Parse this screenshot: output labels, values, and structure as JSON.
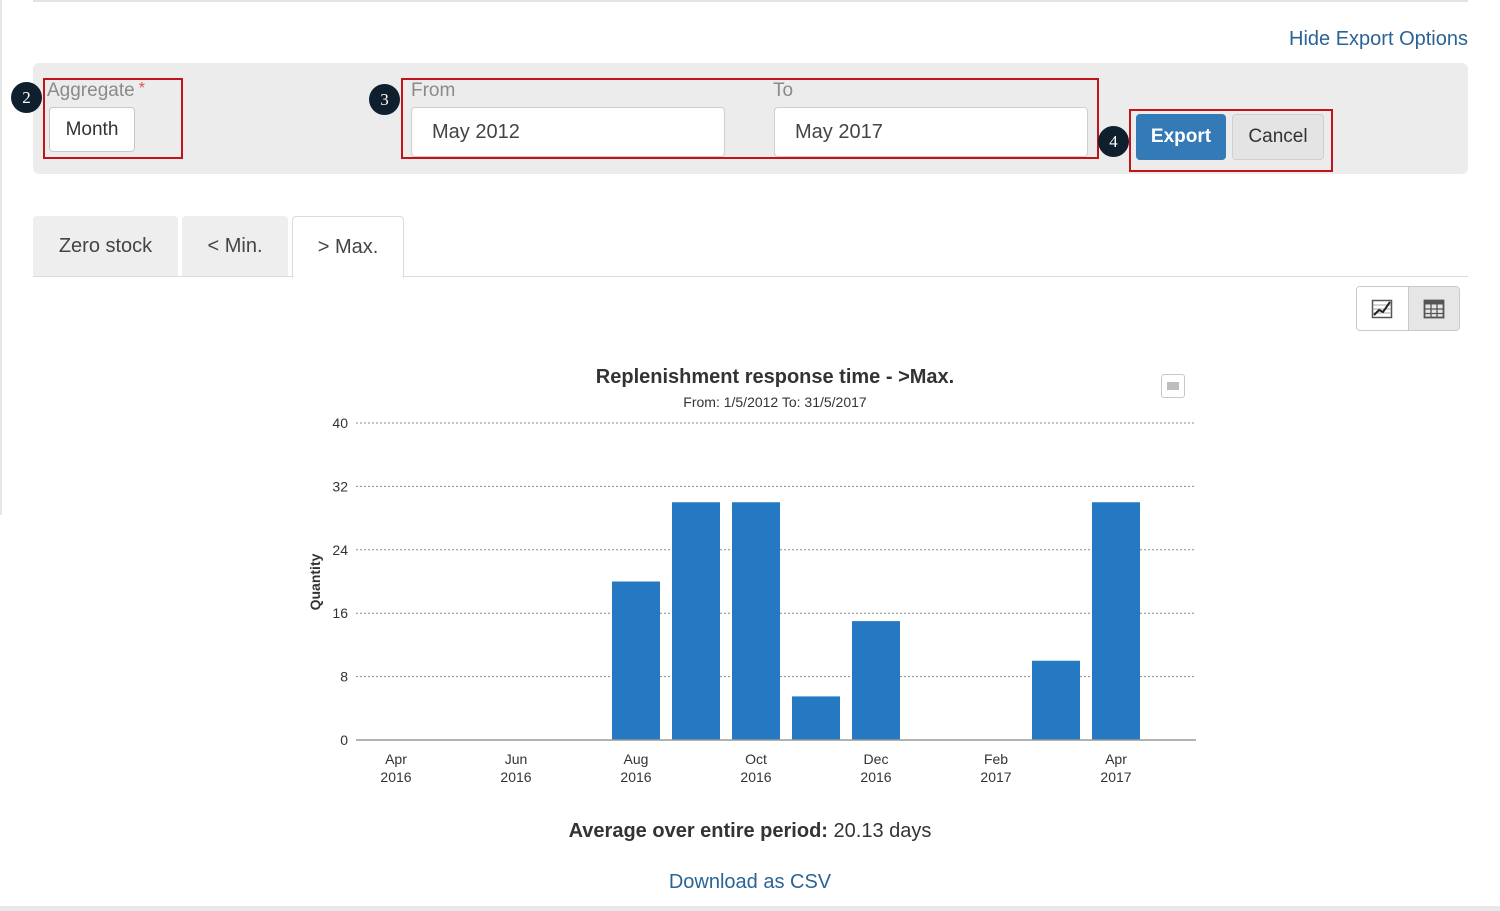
{
  "header": {
    "hide_export_options": "Hide Export Options"
  },
  "export_panel": {
    "aggregate_label": "Aggregate",
    "required_mark": "*",
    "aggregate_value": "Month",
    "from_label": "From",
    "from_value": "May 2012",
    "to_label": "To",
    "to_value": "May 2017",
    "export_label": "Export",
    "cancel_label": "Cancel",
    "badges": [
      "2",
      "3",
      "4"
    ]
  },
  "tabs": [
    {
      "label": "Zero stock"
    },
    {
      "label": "< Min."
    },
    {
      "label": "> Max.",
      "active": true
    }
  ],
  "view_toggle": {
    "chart_icon": "line-chart-icon",
    "table_icon": "table-grid-icon"
  },
  "chart_data": {
    "type": "bar",
    "title": "Replenishment response time - >Max.",
    "subtitle": "From: 1/5/2012 To: 31/5/2017",
    "ylabel": "Quantity",
    "xlabel": "",
    "ylim": [
      0,
      40
    ],
    "yticks": [
      0,
      8,
      16,
      24,
      32,
      40
    ],
    "grid": true,
    "bar_color": "#2479c2",
    "categories": [
      "Apr 2016",
      "May 2016",
      "Jun 2016",
      "Jul 2016",
      "Aug 2016",
      "Sep 2016",
      "Oct 2016",
      "Nov 2016",
      "Dec 2016",
      "Jan 2017",
      "Feb 2017",
      "Mar 2017",
      "Apr 2017"
    ],
    "values": [
      0,
      0,
      0,
      0,
      20,
      30,
      30,
      5.5,
      15,
      0,
      0,
      10,
      30
    ],
    "tick_labels": [
      {
        "index": 0,
        "line1": "Apr",
        "line2": "2016"
      },
      {
        "index": 2,
        "line1": "Jun",
        "line2": "2016"
      },
      {
        "index": 4,
        "line1": "Aug",
        "line2": "2016"
      },
      {
        "index": 6,
        "line1": "Oct",
        "line2": "2016"
      },
      {
        "index": 8,
        "line1": "Dec",
        "line2": "2016"
      },
      {
        "index": 10,
        "line1": "Feb",
        "line2": "2017"
      },
      {
        "index": 12,
        "line1": "Apr",
        "line2": "2017"
      }
    ]
  },
  "summary": {
    "avg_label": "Average over entire period:",
    "avg_value": "20.13 days"
  },
  "download": {
    "label": "Download as CSV"
  }
}
